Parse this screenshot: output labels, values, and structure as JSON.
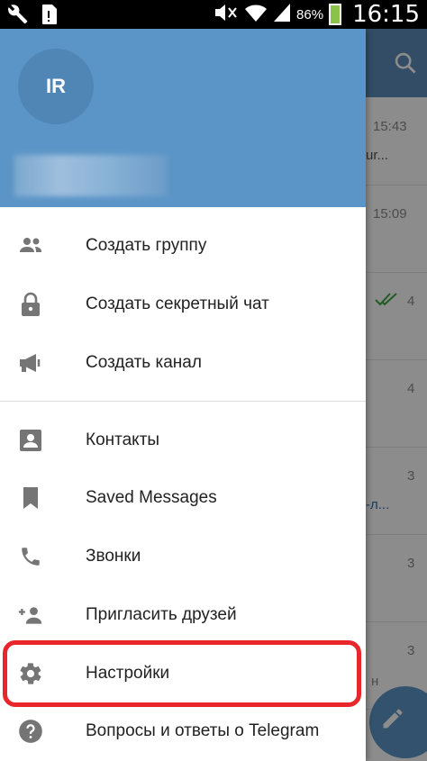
{
  "status_bar": {
    "battery": "86%",
    "time": "16:15",
    "icons": [
      "wrench-icon",
      "sd-card-icon",
      "mute-icon",
      "wifi-icon",
      "signal-icon",
      "battery-icon"
    ]
  },
  "background_chats": {
    "rows": [
      {
        "time": "15:43",
        "preview": "ur..."
      },
      {
        "time": "15:09",
        "preview": ""
      },
      {
        "badge": "4"
      },
      {
        "badge": "4"
      },
      {
        "badge": "3",
        "preview": "-л..."
      },
      {
        "badge": "3"
      },
      {
        "badge": "3",
        "preview": "н"
      }
    ]
  },
  "drawer": {
    "avatar_initials": "IR",
    "menu": [
      {
        "label": "Создать группу",
        "icon": "group-icon"
      },
      {
        "label": "Создать секретный чат",
        "icon": "lock-icon"
      },
      {
        "label": "Создать канал",
        "icon": "megaphone-icon"
      },
      {
        "label": "Контакты",
        "icon": "contacts-icon"
      },
      {
        "label": "Saved Messages",
        "icon": "bookmark-icon"
      },
      {
        "label": "Звонки",
        "icon": "phone-icon"
      },
      {
        "label": "Пригласить друзей",
        "icon": "add-person-icon"
      },
      {
        "label": "Настройки",
        "icon": "gear-icon"
      },
      {
        "label": "Вопросы и ответы о Telegram",
        "icon": "help-icon"
      }
    ]
  },
  "colors": {
    "header": "#5b95c7",
    "highlight": "#e8262b",
    "icon": "#757575"
  }
}
